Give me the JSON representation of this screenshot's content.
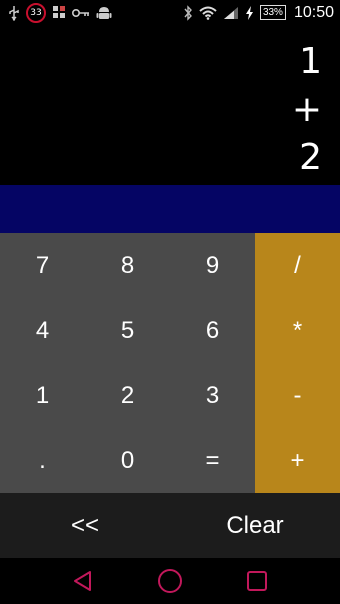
{
  "statusbar": {
    "notification_count": "33",
    "battery": "33%",
    "time": "10:50"
  },
  "display": {
    "lines": [
      "1",
      "+",
      "2"
    ]
  },
  "keypad": {
    "digits": [
      "7",
      "8",
      "9",
      "4",
      "5",
      "6",
      "1",
      "2",
      "3",
      ".",
      "0",
      "="
    ],
    "ops": [
      "/",
      "*",
      "-",
      "+"
    ],
    "backspace": "<<",
    "clear": "Clear"
  },
  "colors": {
    "display_bg": "#000000",
    "result_bar": "#050564",
    "digit_pad": "#4a4a4a",
    "op_pad": "#b8861b",
    "bottom_row": "#1c1c1c",
    "nav_accent": "#c2185b"
  },
  "icons": [
    "usb-icon",
    "notification-badge-icon",
    "sim-icon",
    "key-icon",
    "android-icon",
    "bluetooth-icon",
    "wifi-icon",
    "signal-icon",
    "charging-icon",
    "back-icon",
    "home-icon",
    "recents-icon"
  ]
}
